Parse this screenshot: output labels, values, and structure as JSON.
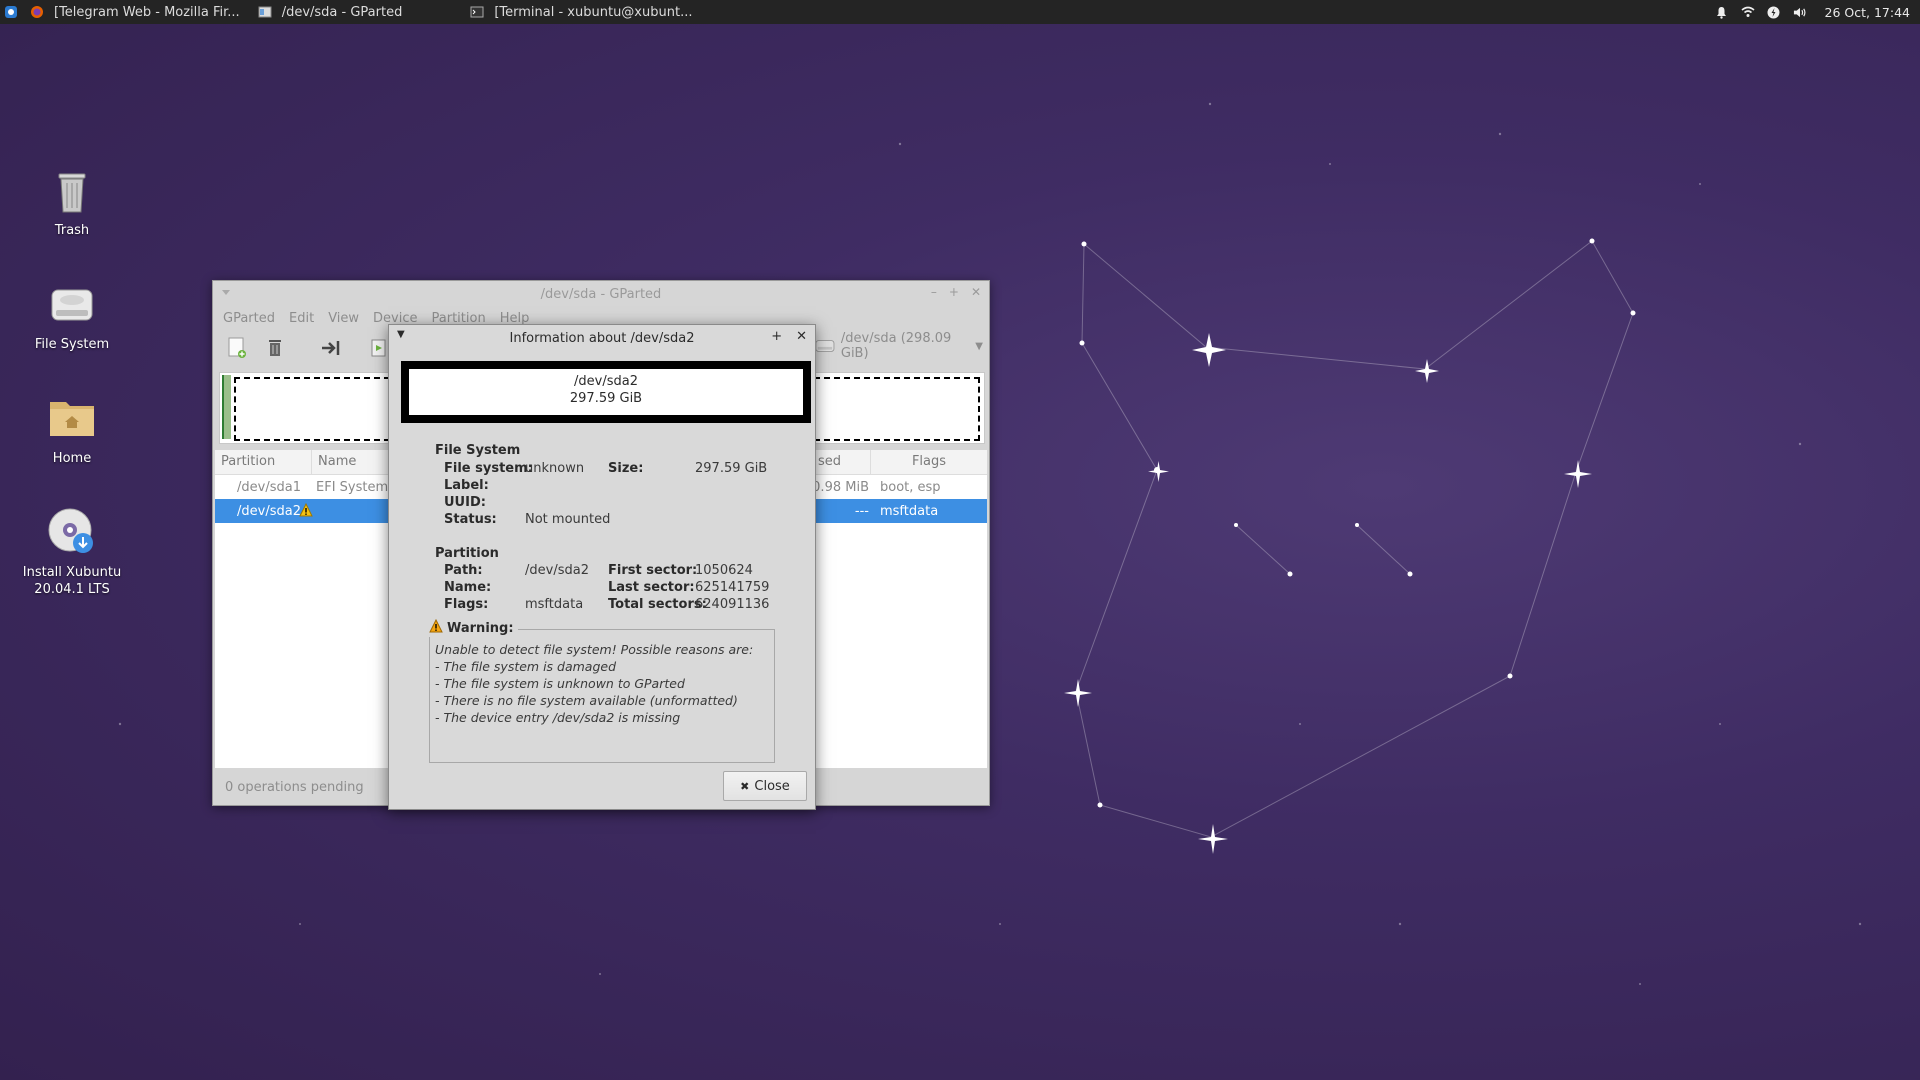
{
  "panel": {
    "tasks": [
      {
        "label": "[Telegram Web - Mozilla Fir...",
        "icon": "firefox-icon"
      },
      {
        "label": "/dev/sda - GParted",
        "icon": "gparted-icon"
      },
      {
        "label": "[Terminal - xubuntu@xubunt...",
        "icon": "terminal-icon"
      }
    ],
    "clock": "26 Oct, 17:44"
  },
  "desktop": {
    "icons": [
      {
        "label": "Trash",
        "icon": "trash-icon"
      },
      {
        "label": "File System",
        "icon": "drive-icon"
      },
      {
        "label": "Home",
        "icon": "home-folder-icon"
      },
      {
        "label": "Install Xubuntu 20.04.1 LTS",
        "icon": "install-disc-icon"
      }
    ]
  },
  "gparted": {
    "title": "/dev/sda - GParted",
    "menu": [
      "GParted",
      "Edit",
      "View",
      "Device",
      "Partition",
      "Help"
    ],
    "device": "/dev/sda (298.09 GiB)",
    "columns": [
      "Partition",
      "Name",
      "sed",
      "Flags"
    ],
    "rows": [
      {
        "partition": "/dev/sda1",
        "name": "EFI System P",
        "used": "10.98 MiB",
        "flags": "boot, esp"
      },
      {
        "partition": "/dev/sda2",
        "name": "",
        "used": "---",
        "flags": "msftdata"
      }
    ],
    "status": "0 operations pending"
  },
  "info": {
    "title": "Information about /dev/sda2",
    "partition_name": "/dev/sda2",
    "partition_size": "297.59 GiB",
    "filesystem": {
      "heading": "File System",
      "fs_label": "File system:",
      "fs_value": "unknown",
      "size_label": "Size:",
      "size_value": "297.59 GiB",
      "label_label": "Label:",
      "uuid_label": "UUID:",
      "status_label": "Status:",
      "status_value": "Not mounted"
    },
    "partition": {
      "heading": "Partition",
      "path_label": "Path:",
      "path_value": "/dev/sda2",
      "first_label": "First sector:",
      "first_value": "1050624",
      "name_label": "Name:",
      "last_label": "Last sector:",
      "last_value": "625141759",
      "flags_label": "Flags:",
      "flags_value": "msftdata",
      "total_label": "Total sectors:",
      "total_value": "624091136"
    },
    "warning": {
      "title": "Warning:",
      "lines": [
        "Unable to detect file system! Possible reasons are:",
        "- The file system is damaged",
        "- The file system is unknown to GParted",
        "- There is no file system available (unformatted)",
        "- The device entry /dev/sda2 is missing"
      ]
    },
    "close_label": "Close"
  }
}
